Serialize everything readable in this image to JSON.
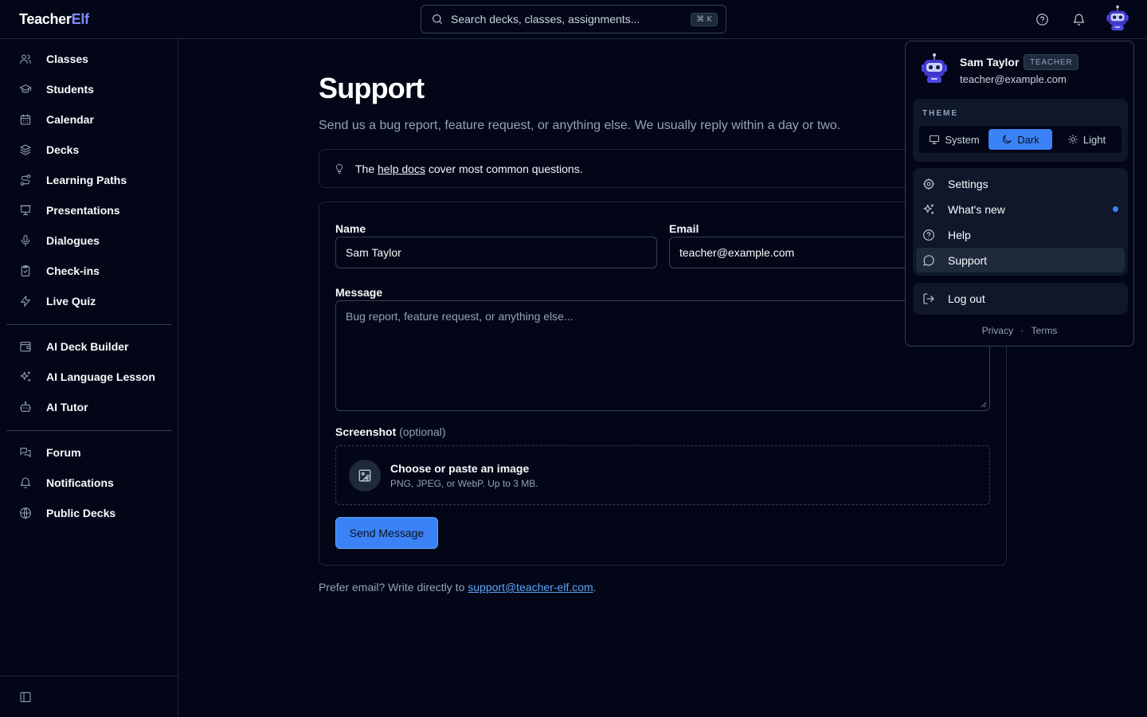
{
  "brand": {
    "part1": "Teacher",
    "part2": "Elf"
  },
  "search": {
    "placeholder": "Search decks, classes, assignments...",
    "shortcut": "⌘ K"
  },
  "topbar_icons": [
    "help-icon",
    "bell-icon",
    "robot-avatar"
  ],
  "sidebar": {
    "group1": [
      {
        "label": "Classes",
        "icon": "users-icon"
      },
      {
        "label": "Students",
        "icon": "graduation-cap-icon"
      },
      {
        "label": "Calendar",
        "icon": "calendar-icon"
      },
      {
        "label": "Decks",
        "icon": "layers-icon"
      },
      {
        "label": "Learning Paths",
        "icon": "route-icon"
      },
      {
        "label": "Presentations",
        "icon": "presentation-icon"
      },
      {
        "label": "Dialogues",
        "icon": "microphone-icon"
      },
      {
        "label": "Check-ins",
        "icon": "clipboard-check-icon"
      },
      {
        "label": "Live Quiz",
        "icon": "zap-icon"
      }
    ],
    "group2": [
      {
        "label": "AI Deck Builder",
        "icon": "wallet-cards-icon"
      },
      {
        "label": "AI Language Lesson",
        "icon": "sparkles-icon"
      },
      {
        "label": "AI Tutor",
        "icon": "bot-icon"
      }
    ],
    "group3": [
      {
        "label": "Forum",
        "icon": "messages-icon"
      },
      {
        "label": "Notifications",
        "icon": "bell-icon"
      },
      {
        "label": "Public Decks",
        "icon": "globe-icon"
      }
    ]
  },
  "main": {
    "title": "Support",
    "subtitle": "Send us a bug report, feature request, or anything else. We usually reply within a day or two.",
    "tip": {
      "prefix": "The ",
      "link": "help docs",
      "suffix": " cover most common questions."
    },
    "form": {
      "name_label": "Name",
      "name_value": "Sam Taylor",
      "email_label": "Email",
      "email_value": "teacher@example.com",
      "message_label": "Message",
      "message_placeholder": "Bug report, feature request, or anything else...",
      "screenshot_label": "Screenshot",
      "screenshot_optional": "(optional)",
      "drop_title": "Choose or paste an image",
      "drop_sub": "PNG, JPEG, or WebP. Up to 3 MB.",
      "send_label": "Send Message"
    },
    "footer": {
      "prefix": "Prefer email? Write directly to ",
      "link": "support@teacher-elf.com",
      "suffix": "."
    }
  },
  "user_menu": {
    "name": "Sam Taylor",
    "role": "TEACHER",
    "email": "teacher@example.com",
    "theme_label": "THEME",
    "theme_options": [
      "System",
      "Dark",
      "Light"
    ],
    "theme_selected": "Dark",
    "items": [
      {
        "label": "Settings",
        "icon": "gear-icon"
      },
      {
        "label": "What's new",
        "icon": "sparkles-icon",
        "new": true
      },
      {
        "label": "Help",
        "icon": "help-icon"
      },
      {
        "label": "Support",
        "icon": "message-circle-icon",
        "active": true
      }
    ],
    "logout": "Log out",
    "legal": {
      "privacy": "Privacy",
      "sep": "·",
      "terms": "Terms"
    }
  },
  "colors": {
    "accent": "#3b82f6",
    "brand_secondary": "#818cf8",
    "background": "#020617"
  }
}
